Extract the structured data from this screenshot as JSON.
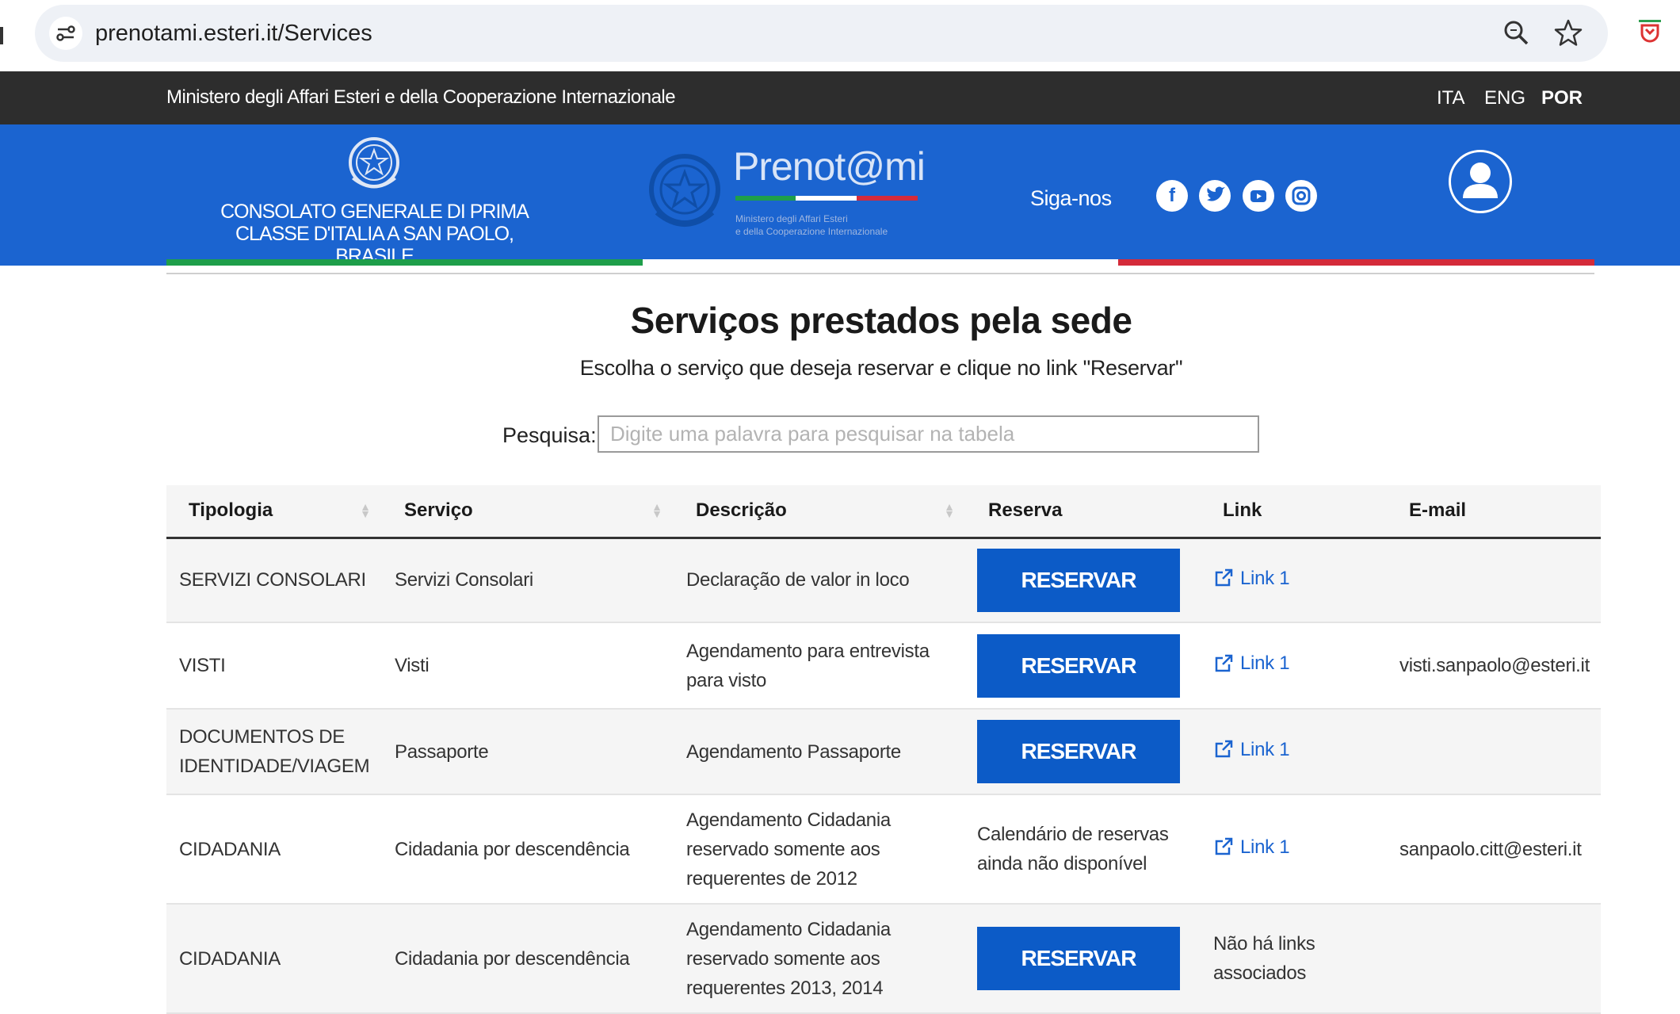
{
  "browser": {
    "url": "prenotami.esteri.it/Services",
    "icons": [
      "tune-icon",
      "zoom-icon",
      "star-icon",
      "extension-icon"
    ]
  },
  "topbar": {
    "ministry": "Ministero degli Affari Esteri e della Cooperazione Internazionale",
    "languages": [
      "ITA",
      "ENG",
      "POR"
    ],
    "active_language": "POR"
  },
  "header": {
    "consulate_line1": "CONSOLATO GENERALE DI PRIMA",
    "consulate_line2": "CLASSE D'ITALIA A SAN PAOLO,",
    "consulate_line3": "BRASILE",
    "brand": "Prenot@mi",
    "brand_sub_line1": "Ministero degli Affari Esteri",
    "brand_sub_line2": "e della Cooperazione Internazionale",
    "follow_label": "Siga-nos",
    "social": [
      "facebook-icon",
      "twitter-icon",
      "youtube-icon",
      "instagram-icon"
    ],
    "colors": {
      "blue": "#1b64d0",
      "green": "#1e9e4a",
      "red": "#d42b3a"
    }
  },
  "main": {
    "title": "Serviços prestados pela sede",
    "subtitle": "Escolha o serviço que deseja reservar e clique no link \"Reservar\"",
    "search_label": "Pesquisa:",
    "search_placeholder": "Digite uma palavra para pesquisar na tabela",
    "search_value": ""
  },
  "table": {
    "headers": [
      "Tipologia",
      "Serviço",
      "Descrição",
      "Reserva",
      "Link",
      "E-mail"
    ],
    "reserve_label": "RESERVAR",
    "rows": [
      {
        "tipologia": "SERVIZI CONSOLARI",
        "servico": "Servizi Consolari",
        "descricao": "Declaração de valor in loco",
        "reserva": "RESERVAR",
        "link": "Link 1",
        "email": ""
      },
      {
        "tipologia": "VISTI",
        "servico": "Visti",
        "descricao": "Agendamento para entrevista para visto",
        "reserva": "RESERVAR",
        "link": "Link 1",
        "email": "visti.sanpaolo@esteri.it"
      },
      {
        "tipologia": "DOCUMENTOS DE IDENTIDADE/VIAGEM",
        "servico": "Passaporte",
        "descricao": "Agendamento Passaporte",
        "reserva": "RESERVAR",
        "link": "Link 1",
        "email": ""
      },
      {
        "tipologia": "CIDADANIA",
        "servico": "Cidadania por descendência",
        "descricao": "Agendamento Cidadania reservado somente aos requerentes de 2012",
        "reserva_text": "Calendário de reservas ainda não disponível",
        "link": "Link 1",
        "email": "sanpaolo.citt@esteri.it"
      },
      {
        "tipologia": "CIDADANIA",
        "servico": "Cidadania por descendência",
        "descricao": "Agendamento Cidadania reservado somente aos requerentes 2013, 2014",
        "reserva": "RESERVAR",
        "link_text": "Não há links associados",
        "email": ""
      }
    ]
  }
}
